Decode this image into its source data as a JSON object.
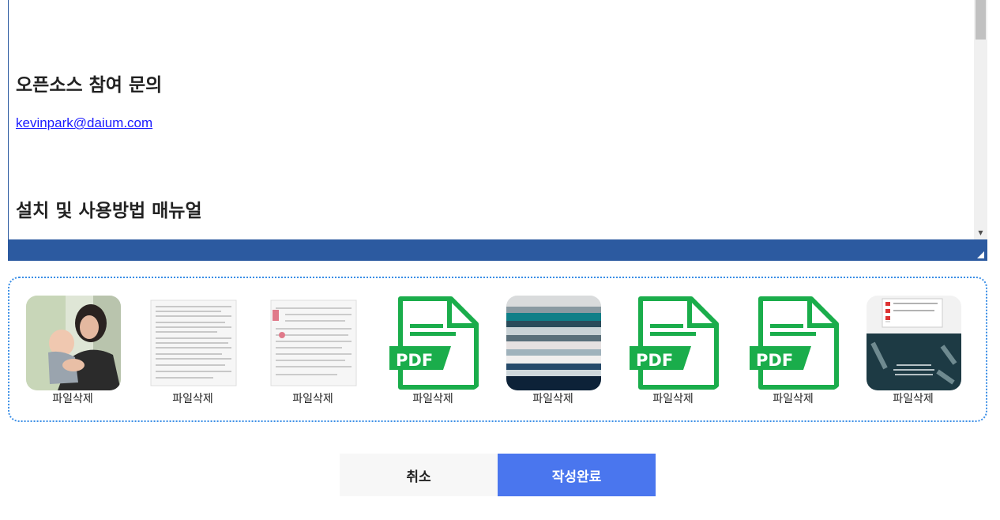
{
  "editor": {
    "heading_contribute": "오픈소스 참여 문의",
    "email": "kevinpark@daium.com",
    "heading_manual": "설치 및 사용방법 매뉴얼"
  },
  "attachments": {
    "items": [
      {
        "type": "photo",
        "delete_label": "파일삭제"
      },
      {
        "type": "document",
        "delete_label": "파일삭제"
      },
      {
        "type": "document-stamped",
        "delete_label": "파일삭제"
      },
      {
        "type": "pdf",
        "icon_text": "PDF",
        "delete_label": "파일삭제"
      },
      {
        "type": "blurred-image",
        "delete_label": "파일삭제"
      },
      {
        "type": "pdf",
        "icon_text": "PDF",
        "delete_label": "파일삭제"
      },
      {
        "type": "pdf",
        "icon_text": "PDF",
        "delete_label": "파일삭제"
      },
      {
        "type": "poster",
        "delete_label": "파일삭제"
      }
    ]
  },
  "actions": {
    "cancel_label": "취소",
    "submit_label": "작성완료"
  },
  "colors": {
    "editor_bar": "#2c5aa0",
    "attach_border": "#3a8ee6",
    "pdf_green": "#1aad4b",
    "submit_bg": "#4a76ee",
    "link": "#1a1aff"
  }
}
